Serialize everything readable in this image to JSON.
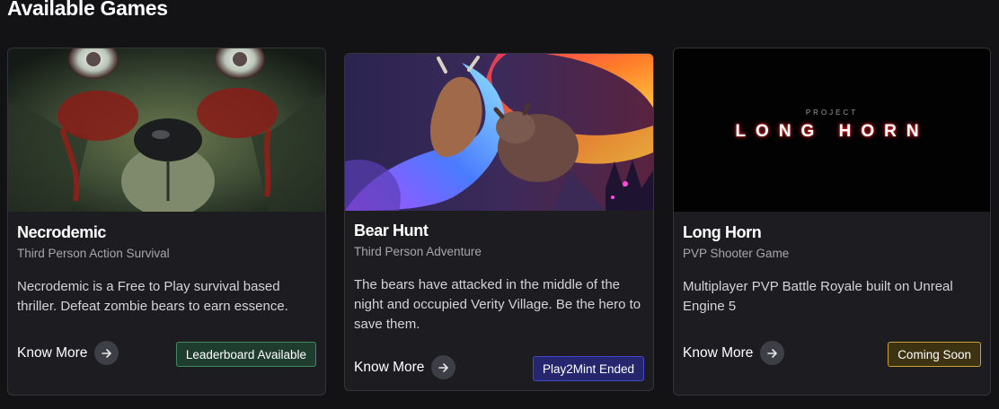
{
  "section": {
    "title": "Available Games"
  },
  "games": [
    {
      "title": "Necrodemic",
      "genre": "Third Person Action Survival",
      "description": "Necrodemic is a Free to Play survival based thriller. Defeat zombie bears to earn essence.",
      "know_more": "Know More",
      "badge": "Leaderboard Available",
      "badge_color": "#3f8a64"
    },
    {
      "title": "Bear Hunt",
      "genre": "Third Person Adventure",
      "description": "The bears have attacked in the middle of the night and occupied Verity Village. Be the hero to save them.",
      "know_more": "Know More",
      "badge": "Play2Mint Ended",
      "badge_color": "#4549c9"
    },
    {
      "title": "Long Horn",
      "genre": "PVP Shooter Game",
      "description": "Multiplayer PVP Battle Royale built on Unreal Engine 5",
      "know_more": "Know More",
      "badge": "Coming Soon",
      "badge_color": "#c9a332",
      "art_small_text": "PROJECT",
      "art_big_text": "LONG HORN"
    }
  ]
}
